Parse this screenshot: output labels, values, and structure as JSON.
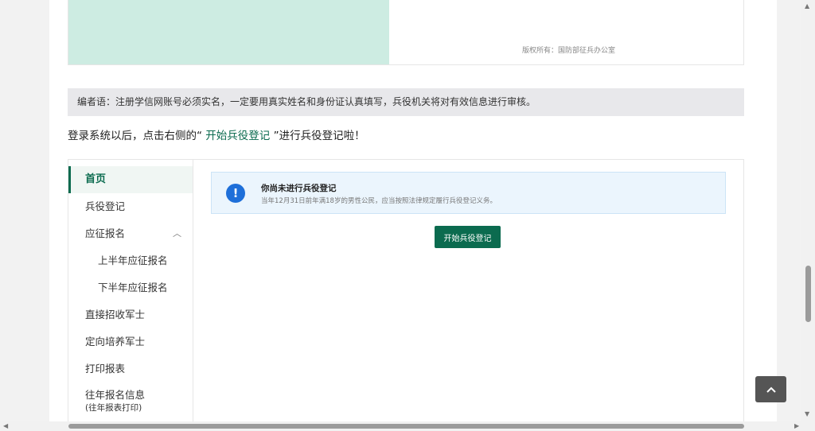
{
  "top": {
    "copyright": "版权所有：国防部征兵办公室"
  },
  "note": {
    "text": "编者语：注册学信网账号必须实名，一定要用真实姓名和身份证认真填写，兵役机关将对有效信息进行审核。"
  },
  "instruction": {
    "prefix": "登录系统以后，点击右侧的“",
    "highlight": " 开始兵役登记 ",
    "suffix": "”进行兵役登记啦！"
  },
  "sidebar": {
    "items": [
      {
        "label": "首页"
      },
      {
        "label": "兵役登记"
      },
      {
        "label": "应征报名"
      },
      {
        "label": "上半年应征报名"
      },
      {
        "label": "下半年应征报名"
      },
      {
        "label": "直接招收军士"
      },
      {
        "label": "定向培养军士"
      },
      {
        "label": "打印报表"
      },
      {
        "label": "往年报名信息",
        "sub": "(往年报表打印)"
      }
    ]
  },
  "alert": {
    "icon": "exclamation-icon",
    "title": "你尚未进行兵役登记",
    "description": "当年12月31日前年满18岁的男性公民，应当按照法律规定履行兵役登记义务。"
  },
  "start_button": {
    "label": "开始兵役登记"
  },
  "colors": {
    "brand": "#0b6b4f",
    "info": "#1e6fd9",
    "alert_bg": "#ebf5fd"
  }
}
